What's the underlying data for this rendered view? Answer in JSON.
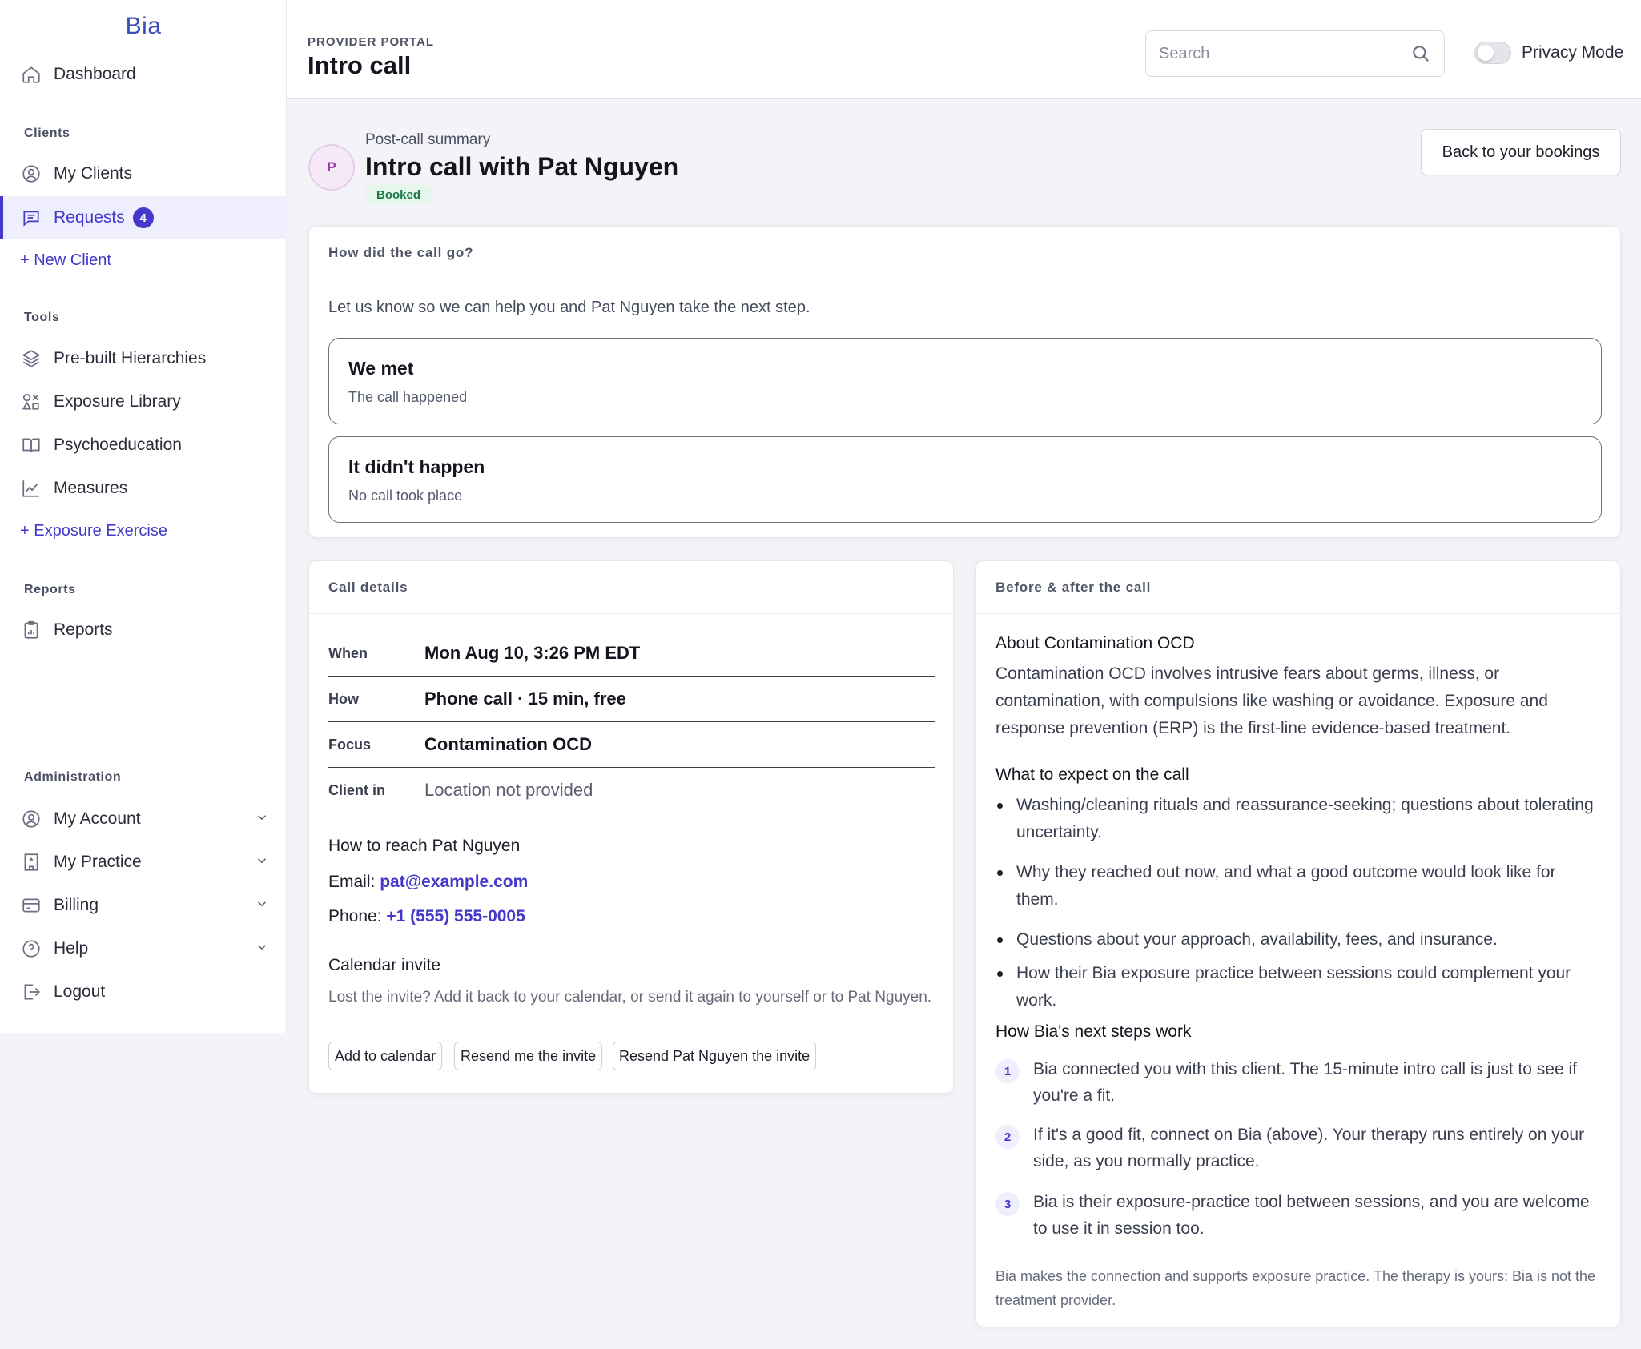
{
  "brand": "Bia",
  "sidebar": {
    "dashboard": "Dashboard",
    "clients_label": "Clients",
    "my_clients": "My Clients",
    "requests": "Requests",
    "requests_count": "4",
    "new_client": "+ New Client",
    "tools_label": "Tools",
    "prebuilt": "Pre-built Hierarchies",
    "exposure_library": "Exposure Library",
    "psychoeducation": "Psychoeducation",
    "measures": "Measures",
    "exposure_exercise": "+ Exposure Exercise",
    "reports_label": "Reports",
    "reports": "Reports",
    "admin_label": "Administration",
    "my_account": "My Account",
    "my_practice": "My Practice",
    "billing": "Billing",
    "help": "Help",
    "logout": "Logout"
  },
  "header": {
    "portal_label": "PROVIDER PORTAL",
    "title": "Intro call",
    "search_placeholder": "Search",
    "privacy_mode": "Privacy Mode"
  },
  "summary": {
    "avatar_initial": "P",
    "label": "Post-call summary",
    "title": "Intro call with Pat Nguyen",
    "status": "Booked",
    "back_button": "Back to your bookings"
  },
  "call_outcome": {
    "heading": "How did the call go?",
    "intro": "Let us know so we can help you and Pat Nguyen take the next step.",
    "options": [
      {
        "title": "We met",
        "subtitle": "The call happened"
      },
      {
        "title": "It didn't happen",
        "subtitle": "No call took place"
      }
    ]
  },
  "call_details": {
    "heading": "Call details",
    "rows": [
      {
        "key": "When",
        "value": "Mon Aug 10, 3:26 PM EDT"
      },
      {
        "key": "How",
        "value": "Phone call · 15 min, free"
      },
      {
        "key": "Focus",
        "value": "Contamination OCD"
      },
      {
        "key": "Client in",
        "value": "Location not provided"
      }
    ],
    "reach_heading": "How to reach Pat Nguyen",
    "email_label": "Email:",
    "email": "pat@example.com",
    "phone_label": "Phone:",
    "phone": "+1 (555) 555-0005",
    "calendar_heading": "Calendar invite",
    "calendar_text": "Lost the invite? Add it back to your calendar, or send it again to yourself or to Pat Nguyen.",
    "buttons": [
      "Add to calendar",
      "Resend me the invite",
      "Resend Pat Nguyen the invite"
    ]
  },
  "before_after": {
    "heading": "Before & after the call",
    "about_heading": "About Contamination OCD",
    "about_text": "Contamination OCD involves intrusive fears about germs, illness, or contamination, with compulsions like washing or avoidance. Exposure and response prevention (ERP) is the first-line evidence-based treatment.",
    "expect_heading": "What to expect on the call",
    "expect_items": [
      "Washing/cleaning rituals and reassurance-seeking; questions about tolerating uncertainty.",
      "Why they reached out now, and what a good outcome would look like for them.",
      "Questions about your approach, availability, fees, and insurance.",
      "How their Bia exposure practice between sessions could complement your work."
    ],
    "steps_heading": "How Bia's next steps work",
    "steps": [
      {
        "num": "1",
        "text": "Bia connected you with this client. The 15-minute intro call is just to see if you're a fit."
      },
      {
        "num": "2",
        "text": "If it's a good fit, connect on Bia (above). Your therapy runs entirely on your side, as you normally practice."
      },
      {
        "num": "3",
        "text": "Bia is their exposure-practice tool between sessions, and you are welcome to use it in session too."
      }
    ],
    "footnote": "Bia makes the connection and supports exposure practice. The therapy is yours: Bia is not the treatment provider."
  }
}
